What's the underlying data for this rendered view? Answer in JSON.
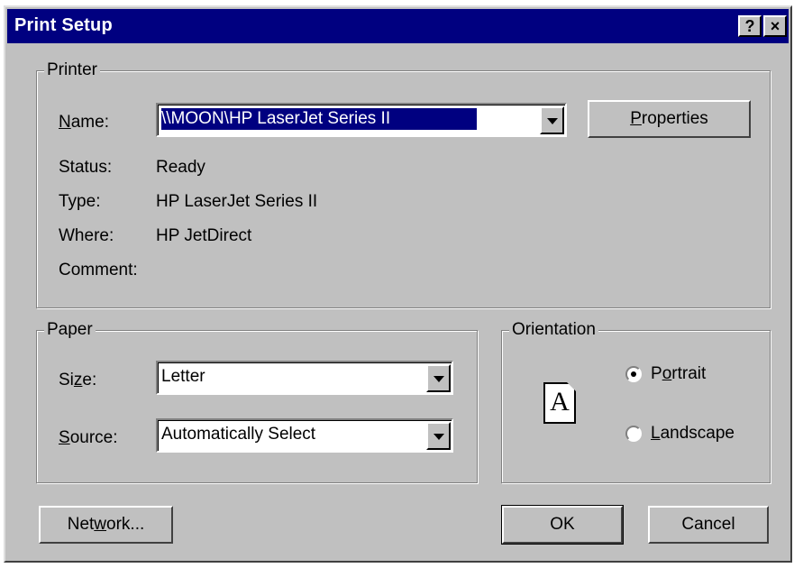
{
  "window": {
    "title": "Print Setup",
    "help_button": "?",
    "close_button": "×"
  },
  "printer": {
    "group_label": "Printer",
    "name_label": {
      "pre": "",
      "mnemonic": "N",
      "post": "ame:"
    },
    "name_value": "\\\\MOON\\HP LaserJet Series II",
    "properties_button": {
      "pre": "",
      "mnemonic": "P",
      "post": "roperties"
    },
    "status_label": "Status:",
    "status_value": "Ready",
    "type_label": "Type:",
    "type_value": "HP LaserJet Series II",
    "where_label": "Where:",
    "where_value": "HP JetDirect",
    "comment_label": "Comment:",
    "comment_value": ""
  },
  "paper": {
    "group_label": "Paper",
    "size_label": {
      "pre": "Si",
      "mnemonic": "z",
      "post": "e:"
    },
    "size_value": "Letter",
    "source_label": {
      "pre": "",
      "mnemonic": "S",
      "post": "ource:"
    },
    "source_value": "Automatically Select"
  },
  "orientation": {
    "group_label": "Orientation",
    "page_icon_letter": "A",
    "portrait": {
      "pre": "P",
      "mnemonic": "o",
      "post": "rtrait",
      "checked": true
    },
    "landscape": {
      "pre": "",
      "mnemonic": "L",
      "post": "andscape",
      "checked": false
    }
  },
  "buttons": {
    "network": {
      "pre": "Net",
      "mnemonic": "w",
      "post": "ork..."
    },
    "ok": "OK",
    "cancel": "Cancel"
  },
  "colors": {
    "title_bar": "#000080",
    "dialog_face": "#c0c0c0",
    "selection": "#000080"
  }
}
